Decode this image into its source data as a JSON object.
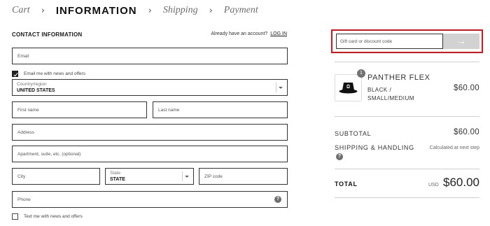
{
  "breadcrumb": {
    "cart": "Cart",
    "information": "INFORMATION",
    "shipping": "Shipping",
    "payment": "Payment",
    "separator": "›"
  },
  "contact": {
    "title": "CONTACT INFORMATION",
    "have_account": "Already have an account?",
    "login": "LOG IN",
    "email_placeholder": "Email",
    "email_offers": {
      "label": "Email me with news and offers",
      "checked": true
    }
  },
  "address": {
    "country_label": "Country/region",
    "country_value": "UNITED STATES",
    "first_name_placeholder": "First name",
    "last_name_placeholder": "Last name",
    "address_placeholder": "Address",
    "apartment_placeholder": "Apartment, suite, etc. (optional)",
    "city_placeholder": "City",
    "state_label": "State",
    "state_value": "STATE",
    "zip_placeholder": "ZIP code",
    "phone_placeholder": "Phone",
    "phone_help": "?",
    "text_offers": {
      "label": "Text me with news and offers",
      "checked": false
    }
  },
  "summary": {
    "discount_placeholder": "Gift card or discount code",
    "discount_button": "→",
    "item": {
      "quantity": "1",
      "name": "PANTHER FLEX",
      "variant": "BLACK / SMALL/MEDIUM",
      "price": "$60.00"
    },
    "subtotal_label": "SUBTOTAL",
    "subtotal_value": "$60.00",
    "shipping_label": "SHIPPING & HANDLING",
    "shipping_help": "?",
    "shipping_value": "Calculated at next step",
    "total_label": "TOTAL",
    "total_currency": "USD",
    "total_value": "$60.00"
  },
  "colors": {
    "highlight_border": "#d9141b",
    "button_disabled": "#d2d2d2",
    "text": "#1a1a1a"
  }
}
